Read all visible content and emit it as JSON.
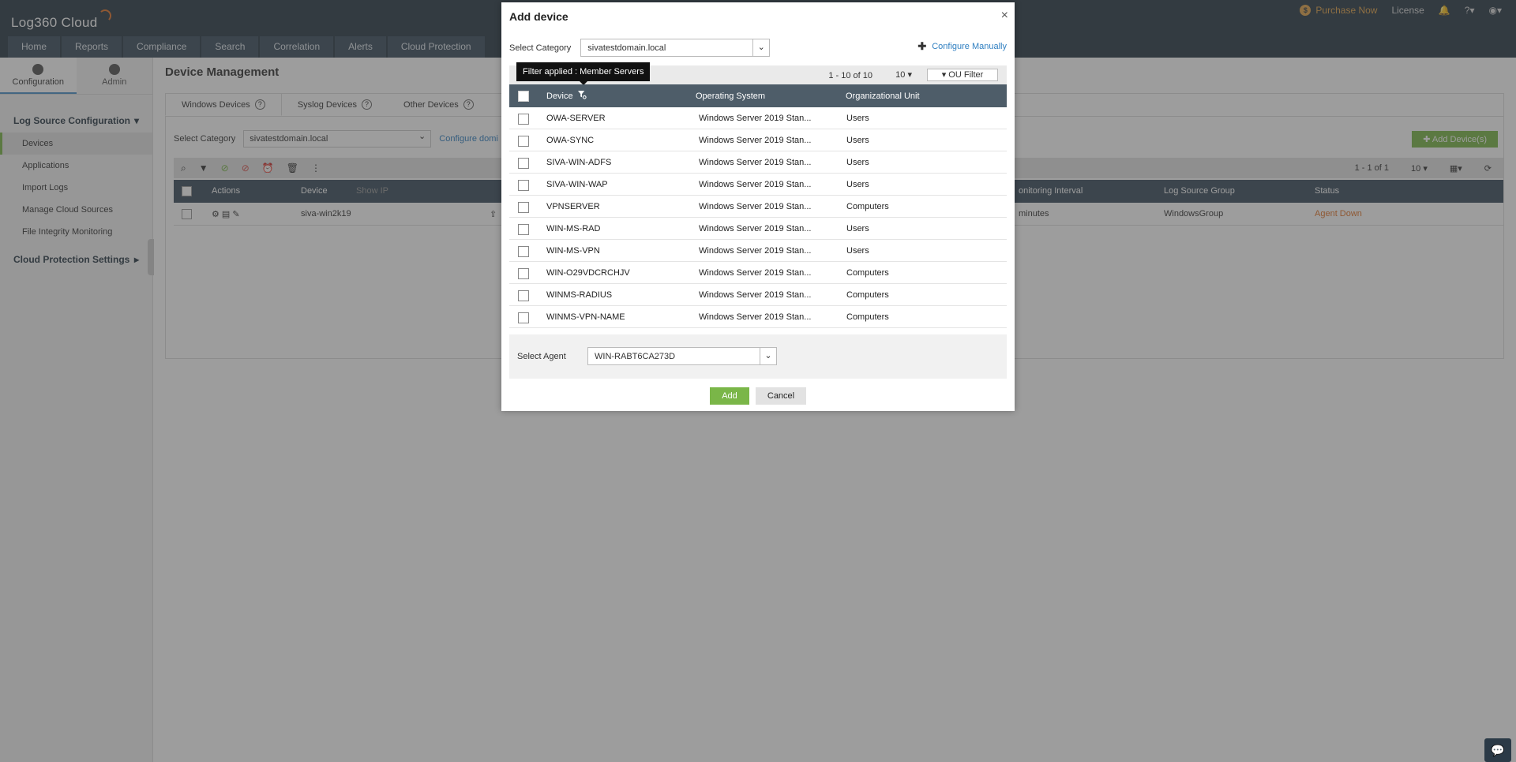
{
  "app": {
    "logo": "Log360 Cloud",
    "purchase": "Purchase Now",
    "license": "License",
    "nav": [
      "Home",
      "Reports",
      "Compliance",
      "Search",
      "Correlation",
      "Alerts",
      "Cloud Protection"
    ]
  },
  "leftbar": {
    "tabs": [
      "Configuration",
      "Admin"
    ],
    "section": "Log Source Configuration",
    "items": [
      "Devices",
      "Applications",
      "Import Logs",
      "Manage Cloud Sources",
      "File Integrity Monitoring"
    ],
    "section2": "Cloud Protection Settings"
  },
  "content": {
    "title": "Device Management",
    "subtabs": [
      "Windows Devices",
      "Syslog Devices",
      "Other Devices"
    ],
    "select_category_label": "Select Category",
    "select_category_value": "sivatestdomain.local",
    "configure_link": "Configure domi",
    "add_devices": "Add Device(s)",
    "pager": "1 - 1 of 1",
    "perpage": "10",
    "columns": {
      "actions": "Actions",
      "device": "Device",
      "show_ip": "Show IP",
      "monitoring": "onitoring Interval",
      "log_source_group": "Log Source Group",
      "status": "Status"
    },
    "row": {
      "device": "siva-win2k19",
      "interval": "minutes",
      "group": "WindowsGroup",
      "status": "Agent Down"
    }
  },
  "modal": {
    "title": "Add device",
    "select_category_label": "Select Category",
    "select_category_value": "sivatestdomain.local",
    "configure_manually": "Configure Manually",
    "tooltip": "Filter applied : Member Servers",
    "pager": "1 - 10 of 10",
    "perpage": "10",
    "ou_filter": "OU Filter",
    "columns": {
      "device": "Device",
      "os": "Operating System",
      "ou": "Organizational Unit"
    },
    "rows": [
      {
        "device": "OWA-SERVER",
        "os": "Windows Server 2019 Stan...",
        "ou": "Users"
      },
      {
        "device": "OWA-SYNC",
        "os": "Windows Server 2019 Stan...",
        "ou": "Users"
      },
      {
        "device": "SIVA-WIN-ADFS",
        "os": "Windows Server 2019 Stan...",
        "ou": "Users"
      },
      {
        "device": "SIVA-WIN-WAP",
        "os": "Windows Server 2019 Stan...",
        "ou": "Users"
      },
      {
        "device": "VPNSERVER",
        "os": "Windows Server 2019 Stan...",
        "ou": "Computers"
      },
      {
        "device": "WIN-MS-RAD",
        "os": "Windows Server 2019 Stan...",
        "ou": "Users"
      },
      {
        "device": "WIN-MS-VPN",
        "os": "Windows Server 2019 Stan...",
        "ou": "Users"
      },
      {
        "device": "WIN-O29VDCRCHJV",
        "os": "Windows Server 2019 Stan...",
        "ou": "Computers"
      },
      {
        "device": "WINMS-RADIUS",
        "os": "Windows Server 2019 Stan...",
        "ou": "Computers"
      },
      {
        "device": "WINMS-VPN-NAME",
        "os": "Windows Server 2019 Stan...",
        "ou": "Computers"
      }
    ],
    "select_agent_label": "Select Agent",
    "select_agent_value": "WIN-RABT6CA273D",
    "add": "Add",
    "cancel": "Cancel"
  },
  "colors": {
    "topbar": "#2b3a47",
    "accent_green": "#7ab648",
    "link_blue": "#2f7fc1",
    "status_down": "#e2742a"
  }
}
